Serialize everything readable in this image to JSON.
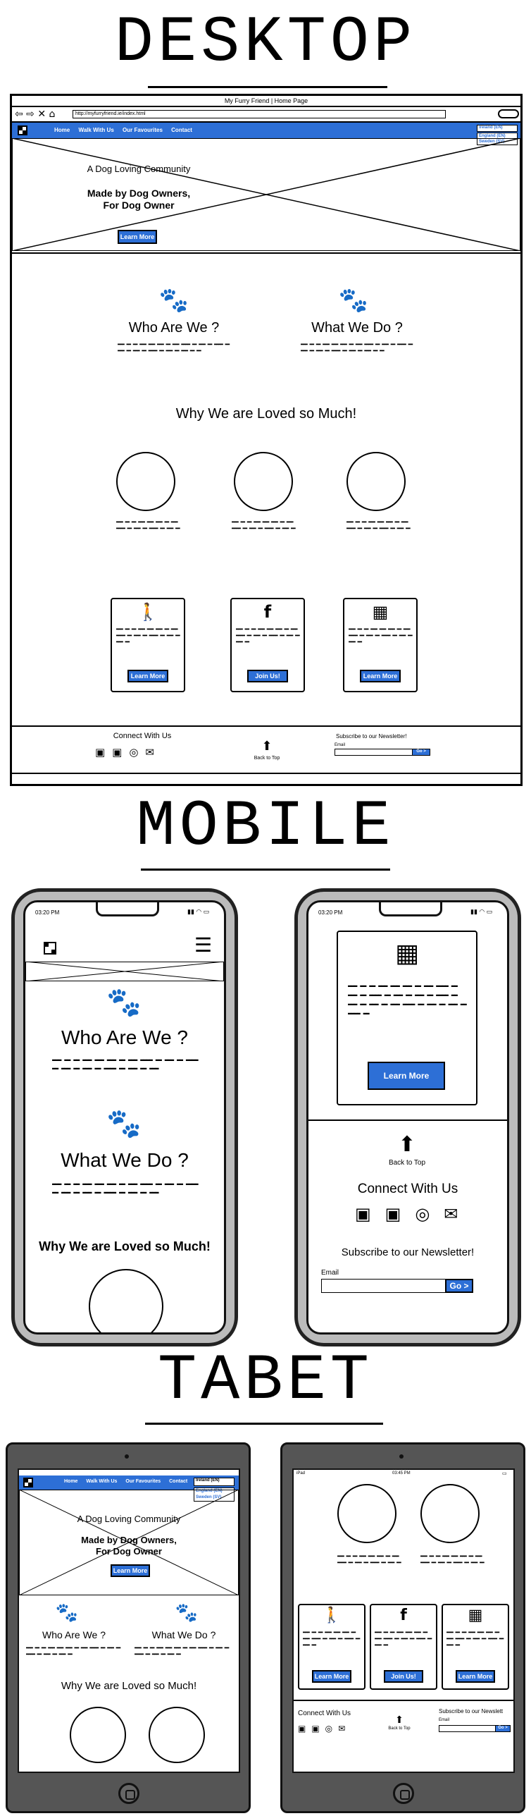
{
  "headings": {
    "desktop": "DESKTOP",
    "mobile": "MOBILE",
    "tablet": "TABET"
  },
  "desktop": {
    "window_title": "My Furry Friend | Home Page",
    "url": "http://myfurryfriend.ie/index.html",
    "nav": [
      "Home",
      "Walk With Us",
      "Our Favourites",
      "Contact"
    ],
    "lang_select": "Ireland (EN)",
    "lang_options": [
      "England (EN)",
      "Sweden (SV)"
    ],
    "hero_tagline": "A Dog Loving Community",
    "hero_line1": "Made by Dog Owners,",
    "hero_line2": "For Dog Owner",
    "hero_button": "Learn More",
    "who_title": "Who Are We ?",
    "what_title": "What We Do ?",
    "loved_title": "Why We are Loved so Much!",
    "card_buttons": [
      "Learn More",
      "Join Us!",
      "Learn More"
    ],
    "connect": "Connect With Us",
    "back_to_top": "Back to Top",
    "newsletter": "Subscribe to our Newsletter!",
    "email_label": "Email",
    "go": "Go >"
  },
  "mobile": {
    "time": "03:20 PM",
    "who_title": "Who Are We ?",
    "what_title": "What We Do ?",
    "loved_title": "Why We are Loved so Much!",
    "learn_more": "Learn More",
    "back_to_top": "Back to Top",
    "connect": "Connect With Us",
    "newsletter": "Subscribe to our Newsletter!",
    "email_label": "Email",
    "go": "Go >"
  },
  "tablet": {
    "ipad": "iPad",
    "time": "03:45 PM",
    "nav": [
      "Home",
      "Walk With Us",
      "Our Favourites",
      "Contact"
    ],
    "lang_select": "Ireland (EN)",
    "lang_options": [
      "England (EN)",
      "Sweden (SV)"
    ],
    "hero_tagline": "A Dog Loving Community",
    "hero_line1": "Made by Dog Owners,",
    "hero_line2": "For Dog Owner",
    "hero_button": "Learn More",
    "who_title": "Who Are We ?",
    "what_title": "What We Do ?",
    "loved_title": "Why We are Loved so Much!",
    "card_buttons": [
      "Learn More",
      "Join Us!",
      "Learn More"
    ],
    "connect": "Connect With Us",
    "back_to_top": "Back to Top",
    "newsletter": "Subscribe to our Newslett",
    "email_label": "Email",
    "go": "Go >"
  }
}
